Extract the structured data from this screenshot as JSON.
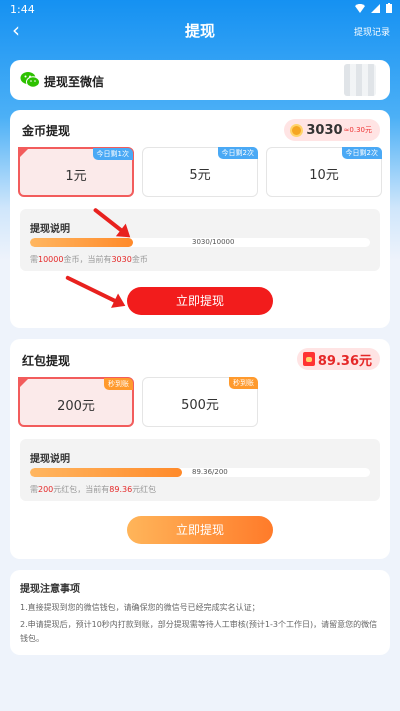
{
  "status": {
    "time": "1:44"
  },
  "header": {
    "back": "‹",
    "title": "提现",
    "records": "提现记录"
  },
  "wechat": {
    "label": "提现至微信"
  },
  "coin": {
    "title": "金币提现",
    "balance": "3030",
    "balance_sub": "≈0.30元",
    "options": [
      {
        "amount": "1元",
        "tag": "今日剩1次",
        "selected": true
      },
      {
        "amount": "5元",
        "tag": "今日剩2次",
        "selected": false
      },
      {
        "amount": "10元",
        "tag": "今日剩2次",
        "selected": false
      }
    ],
    "explain": {
      "title": "提现说明",
      "progress_text": "3030/10000",
      "progress": 0.303,
      "need_prefix": "需",
      "need_value": "10000",
      "need_mid": "金币，当前有",
      "have_value": "3030",
      "have_suffix": "金币"
    },
    "button": "立即提现"
  },
  "redpacket": {
    "title": "红包提现",
    "balance": "89.36元",
    "options": [
      {
        "amount": "200元",
        "tag": "秒到账",
        "selected": true
      },
      {
        "amount": "500元",
        "tag": "秒到账",
        "selected": false
      }
    ],
    "explain": {
      "title": "提现说明",
      "progress_text": "89.36/200",
      "progress": 0.4468,
      "need_prefix": "需",
      "need_value": "200",
      "need_mid": "元红包，当前有",
      "have_value": "89.36",
      "have_suffix": "元红包"
    },
    "button": "立即提现"
  },
  "notice": {
    "title": "提现注意事项",
    "items": [
      "1.直接提现到您的微信钱包，请确保您的微信号已经完成实名认证；",
      "2.申请提现后，预计10秒内打款到账，部分提现需等待人工审核(预计1-3个工作日)，请留意您的微信钱包。"
    ]
  },
  "colors": {
    "accent_blue": "#1591f2",
    "red": "#f21c1c",
    "orange": "#ff8a2a"
  }
}
